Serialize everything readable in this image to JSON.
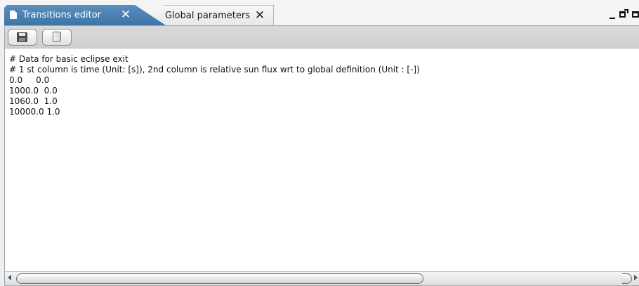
{
  "tabs": [
    {
      "label": "Transitions editor",
      "close": "✕",
      "active": true
    },
    {
      "label": "Global parameters",
      "close": "✕",
      "active": false
    }
  ],
  "window_controls": {
    "minimize": "minimize-icon",
    "maximize": "maximize-icon",
    "restore": "restore-icon"
  },
  "toolbar": {
    "buttons": [
      {
        "icon": "save-icon"
      },
      {
        "icon": "open-file-icon"
      }
    ]
  },
  "editor": {
    "lines": [
      "# Data for basic eclipse exit",
      "# 1 st column is time (Unit: [s]), 2nd column is relative sun flux wrt to global definition (Unit : [-])",
      "0.0     0.0",
      "1000.0  0.0",
      "1060.0  1.0",
      "10000.0 1.0"
    ]
  },
  "colors": {
    "active_tab": "#3d75a8",
    "text": "#111111",
    "editor_background": "#ffffff"
  }
}
